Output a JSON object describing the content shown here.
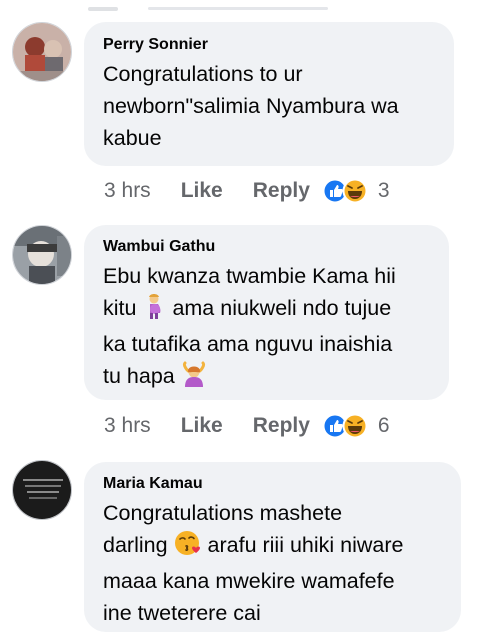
{
  "comments": [
    {
      "author": "Perry Sonnier",
      "lines": [
        "Congratulations to ur",
        "newborn\"salimia Nyambura wa",
        "kabue"
      ],
      "time": "3 hrs",
      "like": "Like",
      "reply": "Reply",
      "reaction_count": "3",
      "reactions": [
        "like-icon",
        "haha-icon"
      ]
    },
    {
      "author": "Wambui Gathu",
      "line1": "Ebu kwanza twambie Kama hii",
      "line2a": "kitu",
      "line2b": "ama niukweli ndo tujue",
      "line3": "ka tutafika ama nguvu inaishia",
      "line4": "tu hapa",
      "time": "3 hrs",
      "like": "Like",
      "reply": "Reply",
      "reaction_count": "6",
      "reactions": [
        "like-icon",
        "haha-icon"
      ],
      "emojis": [
        "pregnant-woman-emoji",
        "raised-hands-person-emoji"
      ]
    },
    {
      "author": "Maria Kamau",
      "line1": "Congratulations mashete",
      "line2a": "darling",
      "line2b": "arafu riii uhiki niware",
      "line3": "maaa kana mwekire wamafefe",
      "line4": "ine  tweterere cai",
      "emojis": [
        "kissing-face-emoji"
      ]
    }
  ],
  "colors": {
    "bubble": "#f0f2f5",
    "meta": "#65676b",
    "like_blue": "#1877f2",
    "haha_yellow": "#f7b125"
  }
}
